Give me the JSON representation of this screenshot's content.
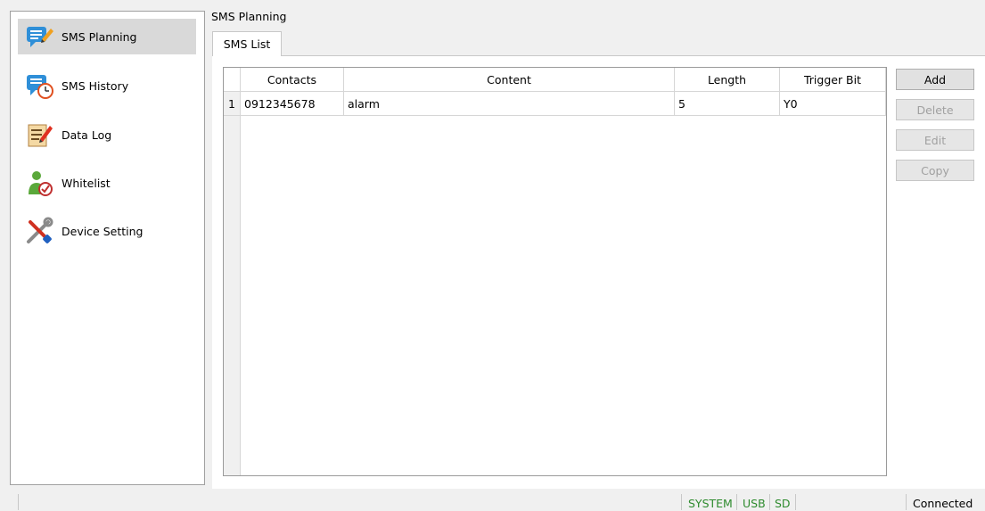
{
  "sidebar": {
    "items": [
      {
        "label": "SMS Planning",
        "icon": "sms-planning-icon",
        "selected": true
      },
      {
        "label": "SMS History",
        "icon": "sms-history-icon",
        "selected": false
      },
      {
        "label": "Data Log",
        "icon": "data-log-icon",
        "selected": false
      },
      {
        "label": "Whitelist",
        "icon": "whitelist-icon",
        "selected": false
      },
      {
        "label": "Device Setting",
        "icon": "device-setting-icon",
        "selected": false
      }
    ]
  },
  "main": {
    "title": "SMS Planning",
    "tabs": [
      {
        "label": "SMS List"
      }
    ],
    "table": {
      "columns": [
        "Contacts",
        "Content",
        "Length",
        "Trigger Bit"
      ],
      "rows": [
        {
          "num": "1",
          "contacts": "0912345678",
          "content": "alarm",
          "length": "5",
          "trigger_bit": "Y0"
        }
      ]
    },
    "buttons": {
      "add": "Add",
      "delete": "Delete",
      "edit": "Edit",
      "copy": "Copy"
    }
  },
  "statusbar": {
    "system": "SYSTEM",
    "usb": "USB",
    "sd": "SD",
    "connection": "Connected",
    "accent": "#2e8b2e"
  }
}
